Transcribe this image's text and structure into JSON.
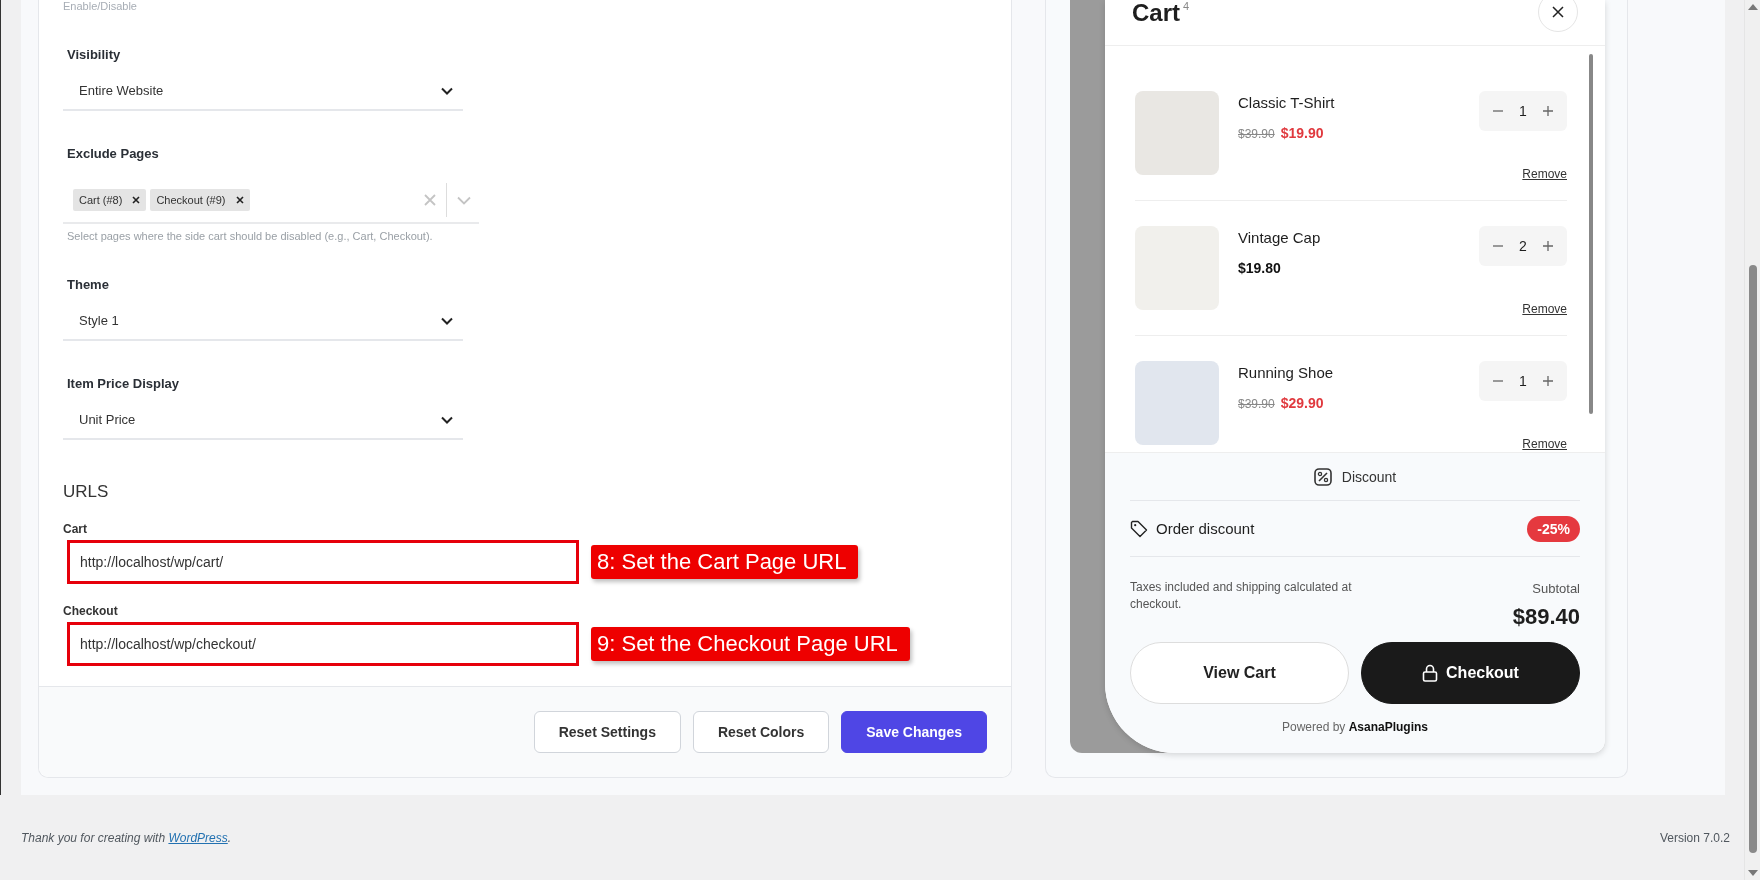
{
  "settings": {
    "top_hint": "Enable/Disable",
    "fields": [
      {
        "kind": "select",
        "label": "Visibility",
        "value": "Entire Website"
      },
      {
        "kind": "multiselect",
        "label": "Exclude Pages",
        "tags": [
          "Cart (#8)",
          "Checkout (#9)"
        ],
        "help": "Select pages where the side cart should be disabled (e.g., Cart, Checkout)."
      },
      {
        "kind": "select",
        "label": "Theme",
        "value": "Style 1"
      },
      {
        "kind": "select",
        "label": "Item Price Display",
        "value": "Unit Price"
      }
    ],
    "urls_heading": "URLS",
    "urls": [
      {
        "label": "Cart",
        "value": "http://localhost/wp/cart/",
        "highlighted": true,
        "annotation": "8: Set the Cart Page URL"
      },
      {
        "label": "Checkout",
        "value": "http://localhost/wp/checkout/",
        "highlighted": true,
        "annotation": "9: Set the Checkout Page URL"
      }
    ],
    "buttons": [
      {
        "label": "Reset Settings",
        "kind": "secondary"
      },
      {
        "label": "Reset Colors",
        "kind": "secondary"
      },
      {
        "label": "Save Changes",
        "kind": "primary"
      }
    ]
  },
  "preview": {
    "cart": {
      "title": "Cart",
      "count": "4",
      "items": [
        {
          "name": "Classic T-Shirt",
          "old_price": "$39.90",
          "price": "$19.90",
          "qty": "1",
          "remove": "Remove"
        },
        {
          "name": "Vintage Cap",
          "price": "$19.80",
          "qty": "2",
          "remove": "Remove"
        },
        {
          "name": "Running Shoe",
          "old_price": "$39.90",
          "price": "$29.90",
          "qty": "1",
          "remove": "Remove"
        }
      ],
      "discount_label": "Discount",
      "order_discount": {
        "label": "Order discount",
        "badge": "-25%"
      },
      "note": "Taxes included and shipping calculated at checkout.",
      "subtotal_label": "Subtotal",
      "subtotal": "$89.40",
      "buttons": [
        {
          "label": "View Cart",
          "kind": "outline"
        },
        {
          "label": "Checkout",
          "kind": "dark"
        }
      ],
      "powered_by": "Powered by **AsanaPlugins**"
    }
  },
  "footer": {
    "thanks": "Thank you for creating with ",
    "link": "WordPress",
    "period": ".",
    "version": "Version 7.0.2"
  }
}
